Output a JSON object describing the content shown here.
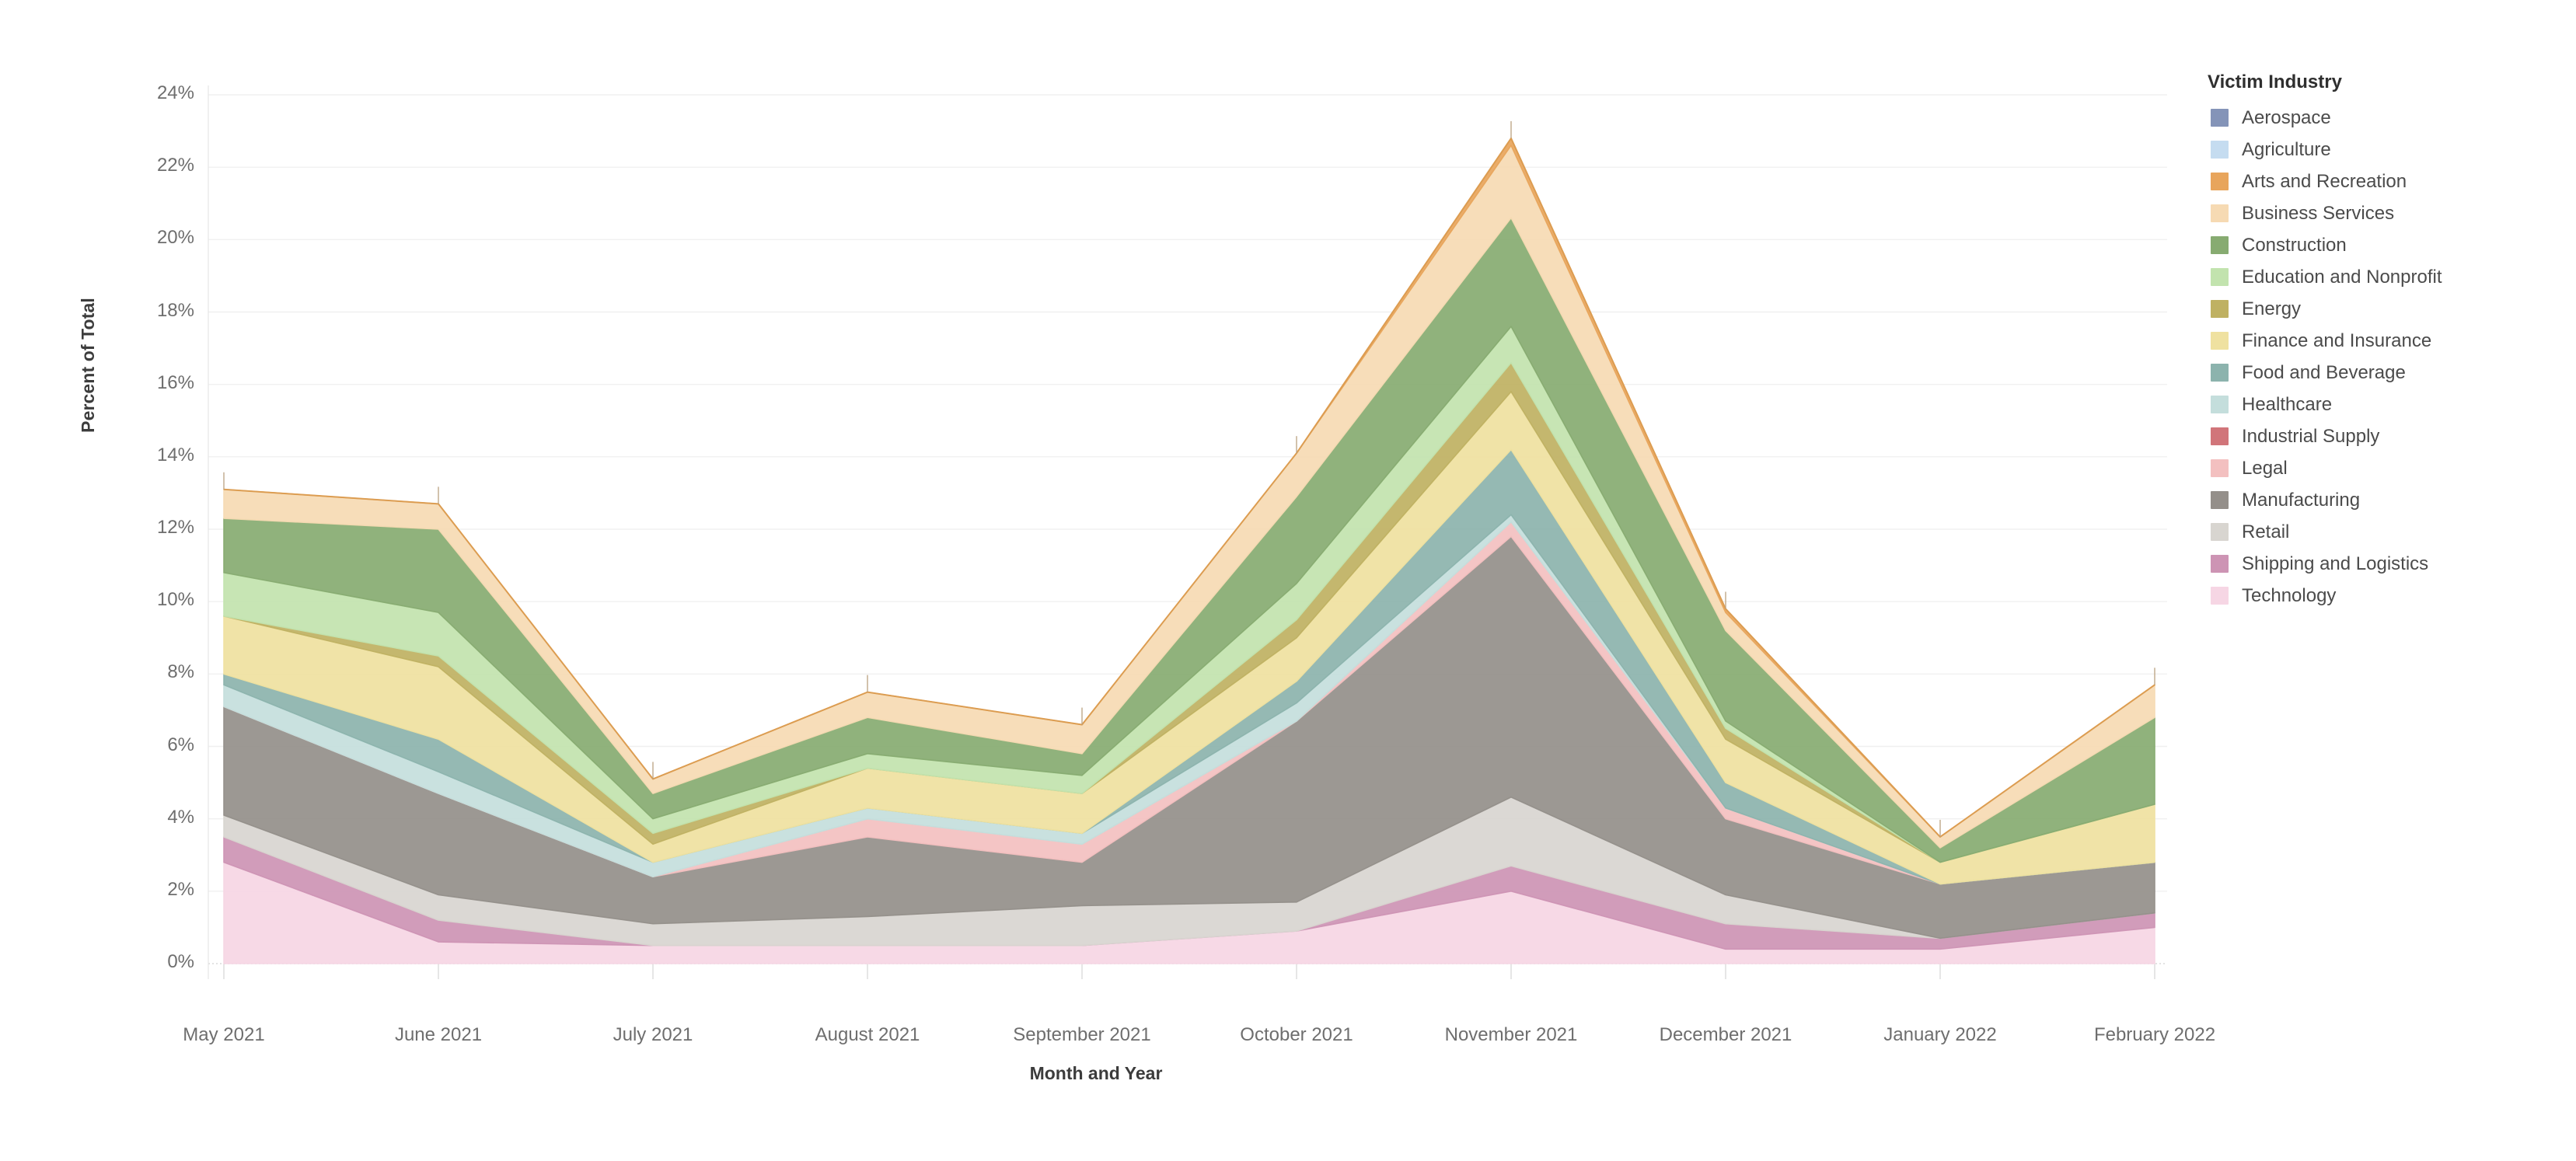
{
  "axes": {
    "ylabel": "Percent of Total",
    "xlabel": "Month and Year",
    "yticks": [
      "0%",
      "2%",
      "4%",
      "6%",
      "8%",
      "10%",
      "12%",
      "14%",
      "16%",
      "18%",
      "20%",
      "22%",
      "24%"
    ]
  },
  "legend": {
    "title": "Victim Industry",
    "items": [
      {
        "label": "Aerospace",
        "color": "#8494b8"
      },
      {
        "label": "Agriculture",
        "color": "#c5dcf0"
      },
      {
        "label": "Arts and Recreation",
        "color": "#e8a55c"
      },
      {
        "label": "Business Services",
        "color": "#f6dab3"
      },
      {
        "label": "Construction",
        "color": "#87ab71"
      },
      {
        "label": "Education and Nonprofit",
        "color": "#c2e3ae"
      },
      {
        "label": "Energy",
        "color": "#bfb162"
      },
      {
        "label": "Finance and Insurance",
        "color": "#efe1a0"
      },
      {
        "label": "Food and Beverage",
        "color": "#8cb3ad"
      },
      {
        "label": "Healthcare",
        "color": "#c4dedc"
      },
      {
        "label": "Industrial Supply",
        "color": "#d1757a"
      },
      {
        "label": "Legal",
        "color": "#f3c0c0"
      },
      {
        "label": "Manufacturing",
        "color": "#948f8a"
      },
      {
        "label": "Retail",
        "color": "#d8d5d0"
      },
      {
        "label": "Shipping and Logistics",
        "color": "#cd94b4"
      },
      {
        "label": "Technology",
        "color": "#f6d6e4"
      }
    ]
  },
  "chart_data": {
    "type": "area",
    "stacked": true,
    "title": "",
    "xlabel": "Month and Year",
    "ylabel": "Percent of Total",
    "ylim": [
      0,
      24
    ],
    "ytick_step": 2,
    "grid": true,
    "legend_position": "right",
    "categories": [
      "May 2021",
      "June 2021",
      "July 2021",
      "August 2021",
      "September 2021",
      "October 2021",
      "November 2021",
      "December 2021",
      "January 2022",
      "February 2022"
    ],
    "series": [
      {
        "name": "Technology",
        "color": "#f6d6e4",
        "values": [
          2.8,
          0.6,
          0.5,
          0.5,
          0.5,
          0.9,
          2.0,
          0.4,
          0.4,
          1.0
        ]
      },
      {
        "name": "Shipping and Logistics",
        "color": "#cd94b4",
        "values": [
          0.7,
          0.6,
          0.0,
          0.0,
          0.0,
          0.0,
          0.7,
          0.7,
          0.3,
          0.4
        ]
      },
      {
        "name": "Retail",
        "color": "#d8d5d0",
        "values": [
          0.6,
          0.7,
          0.6,
          0.8,
          1.1,
          0.8,
          1.9,
          0.8,
          0.0,
          0.0
        ]
      },
      {
        "name": "Manufacturing",
        "color": "#948f8a",
        "values": [
          3.0,
          2.8,
          1.3,
          2.2,
          1.2,
          5.0,
          7.2,
          2.1,
          1.5,
          1.4
        ]
      },
      {
        "name": "Legal",
        "color": "#f3c0c0",
        "values": [
          0.0,
          0.0,
          0.0,
          0.5,
          0.5,
          0.0,
          0.4,
          0.3,
          0.0,
          0.0
        ]
      },
      {
        "name": "Healthcare",
        "color": "#c4dedc",
        "values": [
          0.6,
          0.6,
          0.4,
          0.3,
          0.3,
          0.5,
          0.2,
          0.0,
          0.0,
          0.0
        ]
      },
      {
        "name": "Food and Beverage",
        "color": "#8cb3ad",
        "values": [
          0.3,
          0.9,
          0.0,
          0.0,
          0.0,
          0.6,
          1.8,
          0.7,
          0.0,
          0.0
        ]
      },
      {
        "name": "Finance and Insurance",
        "color": "#efe1a0",
        "values": [
          1.6,
          2.0,
          0.5,
          1.1,
          1.1,
          1.2,
          1.6,
          1.2,
          0.6,
          1.6
        ]
      },
      {
        "name": "Energy",
        "color": "#bfb162",
        "values": [
          0.0,
          0.3,
          0.3,
          0.0,
          0.0,
          0.5,
          0.8,
          0.3,
          0.0,
          0.0
        ]
      },
      {
        "name": "Education and Nonprofit",
        "color": "#c2e3ae",
        "values": [
          1.2,
          1.2,
          0.4,
          0.4,
          0.5,
          1.0,
          1.0,
          0.2,
          0.0,
          0.0
        ]
      },
      {
        "name": "Construction",
        "color": "#87ab71",
        "values": [
          1.5,
          2.3,
          0.7,
          1.0,
          0.6,
          2.4,
          3.0,
          2.5,
          0.4,
          2.4
        ]
      },
      {
        "name": "Business Services",
        "color": "#f6dab3",
        "values": [
          0.8,
          0.7,
          0.4,
          0.7,
          0.8,
          1.2,
          2.0,
          0.5,
          0.3,
          0.9
        ]
      },
      {
        "name": "Arts and Recreation",
        "color": "#e8a55c",
        "values": [
          0.0,
          0.0,
          0.0,
          0.0,
          0.0,
          0.0,
          0.2,
          0.1,
          0.0,
          0.0
        ]
      },
      {
        "name": "Agriculture",
        "color": "#c5dcf0",
        "values": [
          0.0,
          0.0,
          0.0,
          0.0,
          0.0,
          0.0,
          0.0,
          0.0,
          0.0,
          0.0
        ]
      },
      {
        "name": "Aerospace",
        "color": "#8494b8",
        "values": [
          0.0,
          0.0,
          0.0,
          0.0,
          0.0,
          0.0,
          0.0,
          0.0,
          0.0,
          0.0
        ]
      },
      {
        "name": "Industrial Supply",
        "color": "#d1757a",
        "values": [
          0.0,
          0.0,
          0.0,
          0.0,
          0.0,
          0.0,
          0.0,
          0.0,
          0.0,
          0.0
        ]
      }
    ],
    "totals": [
      12.9,
      11.7,
      4.7,
      7.0,
      6.6,
      12.8,
      22.8,
      8.4,
      2.5,
      8.25
    ]
  }
}
